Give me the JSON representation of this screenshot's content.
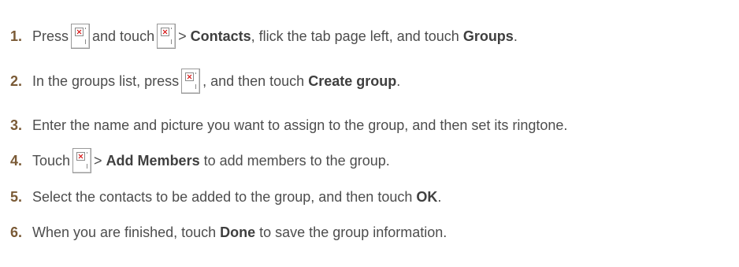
{
  "steps": [
    {
      "num": "1.",
      "parts": [
        "Press",
        "and touch",
        "> ",
        "Contacts",
        ", flick the tab page left, and touch ",
        "Groups",
        "."
      ]
    },
    {
      "num": "2.",
      "parts": [
        "In the groups list, press",
        ", and then touch ",
        "Create group",
        "."
      ]
    },
    {
      "num": "3.",
      "parts": [
        "Enter the name and picture you want to assign to the group, and then set its ringtone."
      ]
    },
    {
      "num": "4.",
      "parts": [
        "Touch",
        "> ",
        "Add Members",
        " to add members to the group."
      ]
    },
    {
      "num": "5.",
      "parts": [
        "Select the contacts to be added to the group, and then touch ",
        "OK",
        "."
      ]
    },
    {
      "num": "6.",
      "parts": [
        "When you are finished, touch ",
        "Done",
        " to save the group information."
      ]
    }
  ],
  "icons": {
    "broken_image": "broken-image-icon"
  },
  "colors": {
    "text": "#4d4d4d",
    "step_number": "#7a5a36",
    "icon_x": "#d40000"
  }
}
